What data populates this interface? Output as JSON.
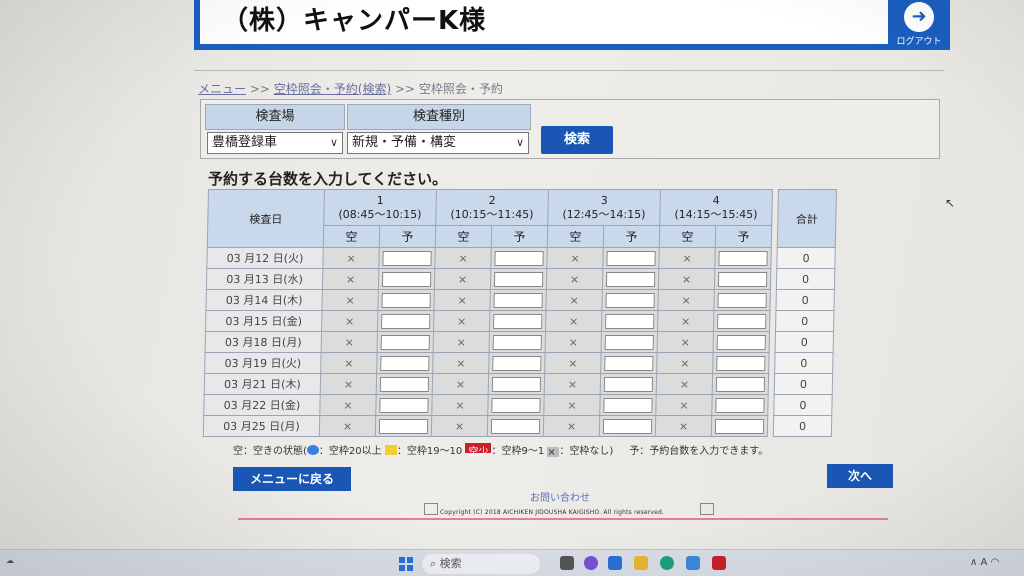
{
  "header": {
    "company": "（株）キャンパーK様",
    "logout_label": "ログアウト"
  },
  "breadcrumb": {
    "menu": "メニュー",
    "sep1": ">>",
    "search": "空枠照会・予約(検索)",
    "sep2": ">>",
    "current": "空枠照会・予約"
  },
  "search_panel": {
    "inspection_site_header": "検査場",
    "inspection_type_header": "検査種別",
    "inspection_site_value": "豊橋登録車",
    "inspection_type_value": "新規・予備・構変",
    "search_button": "検索"
  },
  "instruction": "予約する台数を入力してください。",
  "table": {
    "date_header": "検査日",
    "total_header": "合計",
    "available_header": "空",
    "reserve_header": "予",
    "slots": [
      {
        "num": "1",
        "time": "(08:45～10:15)"
      },
      {
        "num": "2",
        "time": "(10:15～11:45)"
      },
      {
        "num": "3",
        "time": "(12:45～14:15)"
      },
      {
        "num": "4",
        "time": "(14:15～15:45)"
      }
    ],
    "unavailable_mark": "×",
    "rows": [
      {
        "date": "03 月12 日(火)",
        "total": "0"
      },
      {
        "date": "03 月13 日(水)",
        "total": "0"
      },
      {
        "date": "03 月14 日(木)",
        "total": "0"
      },
      {
        "date": "03 月15 日(金)",
        "total": "0"
      },
      {
        "date": "03 月18 日(月)",
        "total": "0"
      },
      {
        "date": "03 月19 日(火)",
        "total": "0"
      },
      {
        "date": "03 月21 日(木)",
        "total": "0"
      },
      {
        "date": "03 月22 日(金)",
        "total": "0"
      },
      {
        "date": "03 月25 日(月)",
        "total": "0"
      }
    ]
  },
  "legend": {
    "prefix": "空：空きの状態(",
    "blue": "：空枠20以上",
    "yellow": "：空枠19～10",
    "red_mark": "空少",
    "red": "：空枠9～1",
    "gray_mark": "×",
    "gray": "：空枠なし)",
    "reserve_note": "予：予約台数を入力できます。"
  },
  "buttons": {
    "back": "メニューに戻る",
    "next": "次へ"
  },
  "contact": "お問い合わせ",
  "copyright": "Copyright (C) 2018 AICHIKEN JIDOUSHA KAIGISHO. All rights reserved.",
  "taskbar": {
    "search_placeholder": "検索",
    "tray_text": "A"
  },
  "colors": {
    "brand_blue": "#1a56b5",
    "header_cell": "#c9d8ea",
    "accent_line": "#e08090"
  }
}
